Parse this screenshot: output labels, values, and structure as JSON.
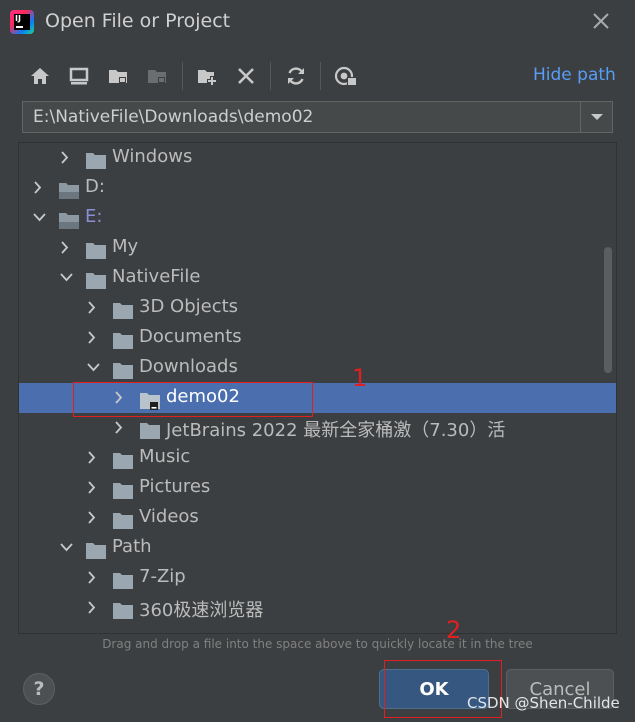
{
  "dialog": {
    "title": "Open File or Project",
    "app_icon": "intellij-logo-icon"
  },
  "toolbar": {
    "buttons": [
      {
        "icon": "home-icon"
      },
      {
        "icon": "desktop-icon"
      },
      {
        "icon": "project-folder-icon"
      },
      {
        "icon": "module-folder-icon"
      },
      {
        "icon": "new-folder-icon"
      },
      {
        "icon": "delete-icon"
      },
      {
        "icon": "refresh-icon"
      },
      {
        "icon": "show-hidden-icon"
      }
    ],
    "hide_path_label": "Hide path"
  },
  "path": {
    "value": "E:\\NativeFile\\Downloads\\demo02"
  },
  "tree": [
    {
      "label": "Windows",
      "level": 1,
      "expanded": false,
      "icon": "folder-icon"
    },
    {
      "label": "D:",
      "level": 0,
      "expanded": false,
      "icon": "drive-icon"
    },
    {
      "label": "E:",
      "level": 0,
      "expanded": true,
      "icon": "drive-icon"
    },
    {
      "label": "My",
      "level": 1,
      "expanded": false,
      "icon": "folder-icon"
    },
    {
      "label": "NativeFile",
      "level": 1,
      "expanded": true,
      "icon": "folder-icon"
    },
    {
      "label": "3D Objects",
      "level": 2,
      "expanded": false,
      "icon": "folder-icon"
    },
    {
      "label": "Documents",
      "level": 2,
      "expanded": false,
      "icon": "folder-icon"
    },
    {
      "label": "Downloads",
      "level": 2,
      "expanded": true,
      "icon": "folder-icon"
    },
    {
      "label": "demo02",
      "level": 3,
      "expanded": false,
      "selected": true,
      "icon": "project-folder-icon"
    },
    {
      "label": "JetBrains  2022 最新全家桶激（7.30）活",
      "level": 3,
      "expanded": false,
      "icon": "folder-icon"
    },
    {
      "label": "Music",
      "level": 2,
      "expanded": false,
      "icon": "folder-icon"
    },
    {
      "label": "Pictures",
      "level": 2,
      "expanded": false,
      "icon": "folder-icon"
    },
    {
      "label": "Videos",
      "level": 2,
      "expanded": false,
      "icon": "folder-icon"
    },
    {
      "label": "Path",
      "level": 1,
      "expanded": true,
      "icon": "folder-icon"
    },
    {
      "label": "7-Zip",
      "level": 2,
      "expanded": false,
      "icon": "folder-icon"
    },
    {
      "label": "360极速浏览器",
      "level": 2,
      "expanded": false,
      "icon": "folder-icon"
    }
  ],
  "hint": "Drag and drop a file into the space above to quickly locate it in the tree",
  "buttons": {
    "help": "?",
    "ok": "OK",
    "cancel": "Cancel"
  },
  "annotations": [
    {
      "label": "1"
    },
    {
      "label": "2"
    }
  ],
  "watermark": "CSDN @Shen-Childe",
  "colors": {
    "background": "#3c3f41",
    "selection": "#4b6eaf",
    "accent": "#589df6",
    "annotation": "#e02020",
    "ok_button": "#365880"
  }
}
